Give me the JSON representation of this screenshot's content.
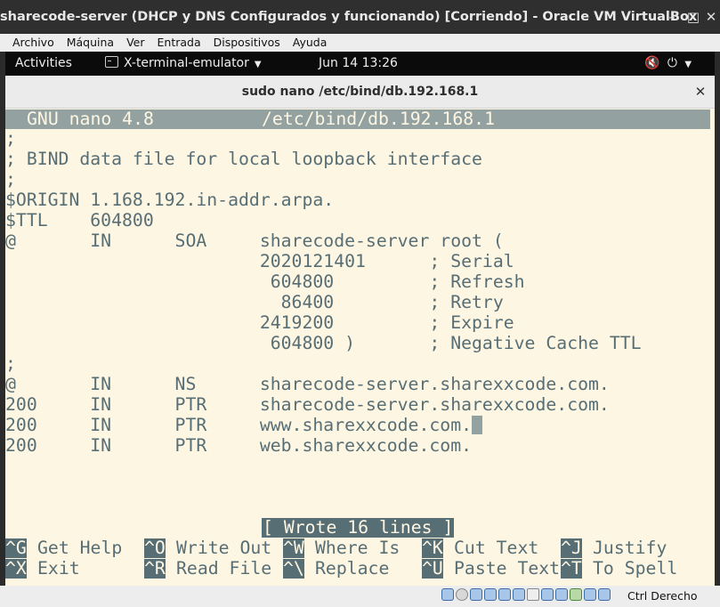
{
  "vbox": {
    "title": "sharecode-server (DHCP y DNS Configurados y funcionando) [Corriendo] - Oracle VM VirtualBox",
    "menu": [
      "Archivo",
      "Máquina",
      "Ver",
      "Entrada",
      "Dispositivos",
      "Ayuda"
    ],
    "host_key": "Ctrl Derecho"
  },
  "gnome": {
    "activities": "Activities",
    "app_name": "X-terminal-emulator",
    "clock": "Jun 14  13:26"
  },
  "terminal": {
    "title": "sudo nano /etc/bind/db.192.168.1"
  },
  "nano": {
    "version": "GNU nano 4.8",
    "filename": "/etc/bind/db.192.168.1",
    "lines": [
      ";",
      "; BIND data file for local loopback interface",
      ";",
      "$ORIGIN 1.168.192.in-addr.arpa.",
      "$TTL    604800",
      "@       IN      SOA     sharecode-server root (",
      "                        2020121401      ; Serial",
      "                         604800         ; Refresh",
      "                          86400         ; Retry",
      "                        2419200         ; Expire",
      "                         604800 )       ; Negative Cache TTL",
      ";",
      "@       IN      NS      sharecode-server.sharexxcode.com.",
      "200     IN      PTR     sharecode-server.sharexxcode.com.",
      "200     IN      PTR     www.sharexxcode.com.",
      "200     IN      PTR     web.sharexxcode.com."
    ],
    "status": "[ Wrote 16 lines ]",
    "shortcuts_row1": [
      {
        "key": "^G",
        "label": "Get Help"
      },
      {
        "key": "^O",
        "label": "Write Out"
      },
      {
        "key": "^W",
        "label": "Where Is"
      },
      {
        "key": "^K",
        "label": "Cut Text"
      },
      {
        "key": "^J",
        "label": "Justify"
      }
    ],
    "shortcuts_row2": [
      {
        "key": "^X",
        "label": "Exit"
      },
      {
        "key": "^R",
        "label": "Read File"
      },
      {
        "key": "^\\",
        "label": "Replace"
      },
      {
        "key": "^U",
        "label": "Paste Text"
      },
      {
        "key": "^T",
        "label": "To Spell"
      }
    ]
  }
}
